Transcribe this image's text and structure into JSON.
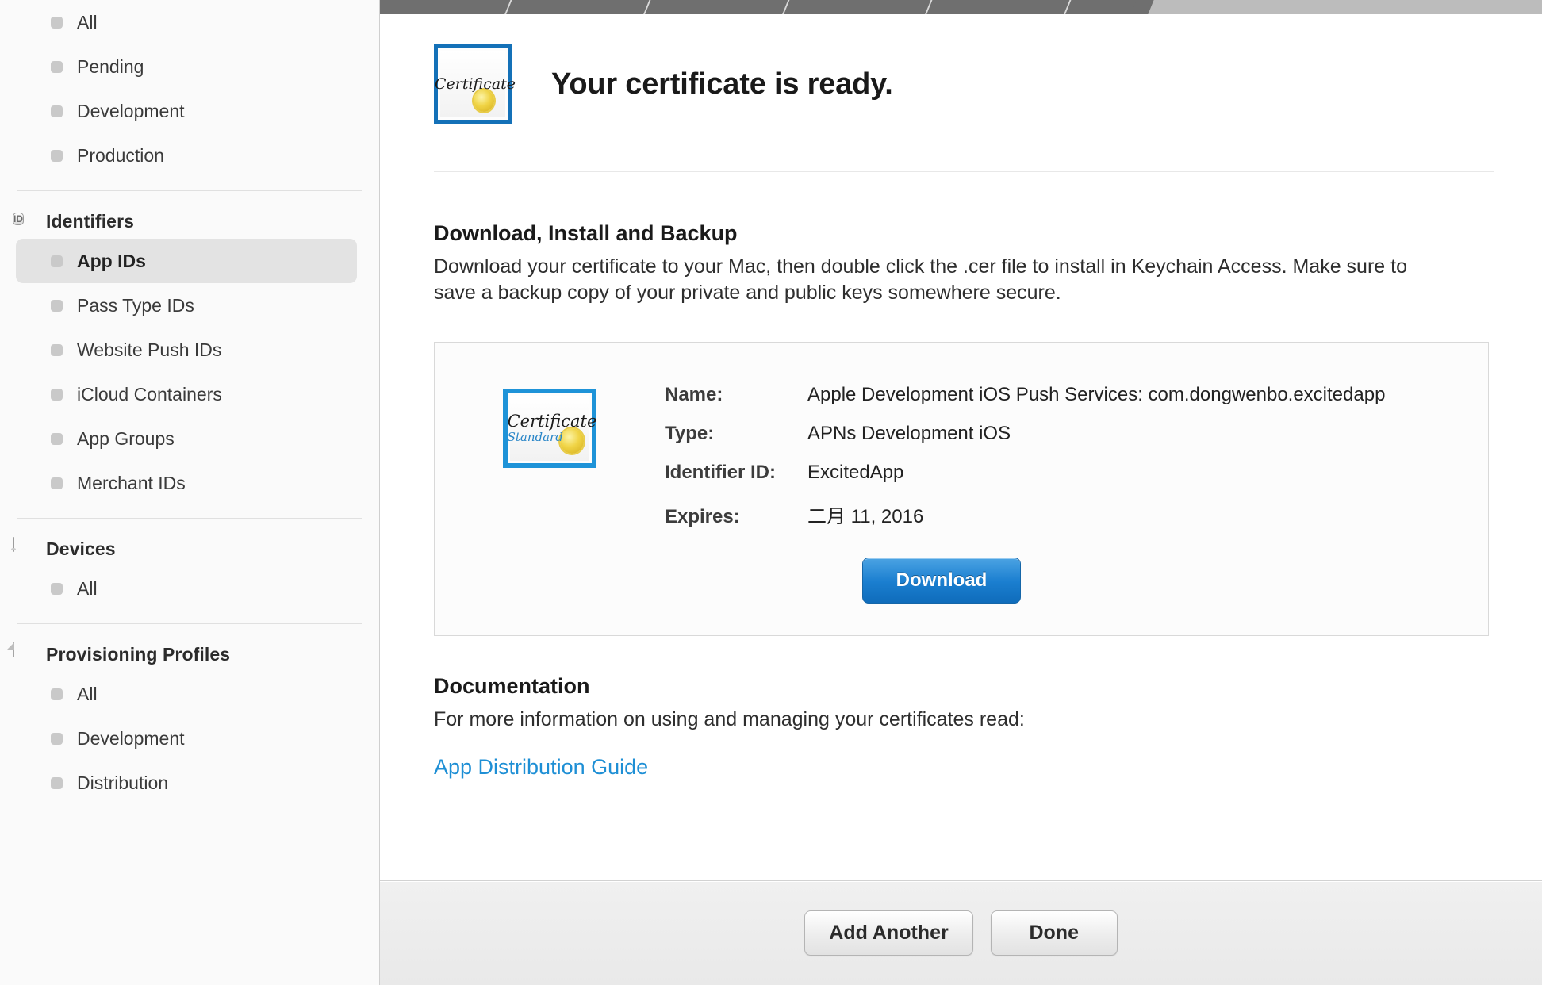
{
  "sidebar": {
    "groups": [
      {
        "header": null,
        "header_icon": null,
        "items": [
          {
            "label": "All",
            "selected": false
          },
          {
            "label": "Pending",
            "selected": false
          },
          {
            "label": "Development",
            "selected": false
          },
          {
            "label": "Production",
            "selected": false
          }
        ]
      },
      {
        "header": "Identifiers",
        "header_icon": "id-badge-icon",
        "icon_text": "ID",
        "items": [
          {
            "label": "App IDs",
            "selected": true
          },
          {
            "label": "Pass Type IDs",
            "selected": false
          },
          {
            "label": "Website Push IDs",
            "selected": false
          },
          {
            "label": "iCloud Containers",
            "selected": false
          },
          {
            "label": "App Groups",
            "selected": false
          },
          {
            "label": "Merchant IDs",
            "selected": false
          }
        ]
      },
      {
        "header": "Devices",
        "header_icon": "phone-icon",
        "items": [
          {
            "label": "All",
            "selected": false
          }
        ]
      },
      {
        "header": "Provisioning Profiles",
        "header_icon": "document-icon",
        "items": [
          {
            "label": "All",
            "selected": false
          },
          {
            "label": "Development",
            "selected": false
          },
          {
            "label": "Distribution",
            "selected": false
          }
        ]
      }
    ]
  },
  "main": {
    "page_title": "Your certificate is ready.",
    "header_icon": "certificate-icon",
    "certificate_badge": {
      "script_title": "Certificate",
      "script_subtitle": "Standard",
      "seal": "gold-seal-icon"
    },
    "sections": {
      "download": {
        "heading": "Download, Install and Backup",
        "body": "Download your certificate to your Mac, then double click the .cer file to install in Keychain Access. Make sure to save a backup copy of your private and public keys somewhere secure."
      },
      "documentation": {
        "heading": "Documentation",
        "body": "For more information on using and managing your certificates read:",
        "link_label": "App Distribution Guide"
      }
    },
    "certificate": {
      "icon": "certificate-standard-icon",
      "rows": [
        {
          "label": "Name:",
          "value": "Apple Development iOS Push Services: com.dongwenbo.excitedapp"
        },
        {
          "label": "Type:",
          "value": "APNs Development iOS"
        },
        {
          "label": "Identifier ID:",
          "value": "ExcitedApp"
        },
        {
          "label": "Expires:",
          "value": "二月 11, 2016"
        }
      ],
      "download_button": "Download"
    }
  },
  "footer": {
    "add_another_label": "Add Another",
    "done_label": "Done"
  },
  "colors": {
    "accent_blue": "#1b7fd0",
    "link_blue": "#1e8fd5",
    "cert_border_blue": "#1471b8",
    "seal_gold": "#f0d446",
    "sidebar_bg": "#fafafa",
    "selected_item_bg": "#e3e3e3",
    "stepbar_done": "#6f6f6f",
    "stepbar_todo": "#bcbcbc"
  }
}
